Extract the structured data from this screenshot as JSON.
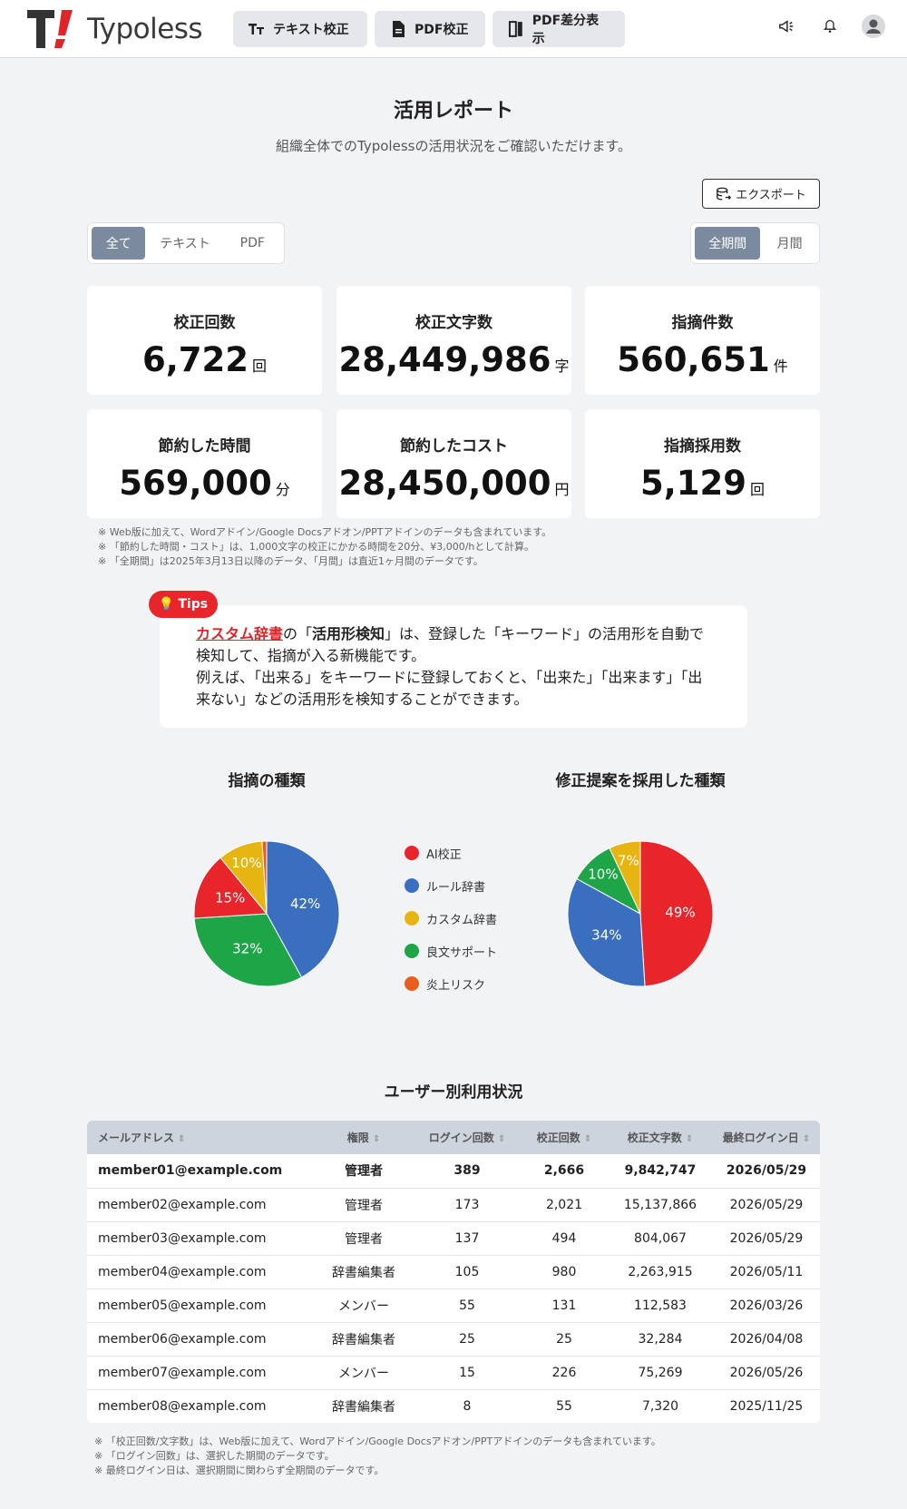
{
  "header": {
    "brand": "Typoless",
    "nav": [
      {
        "label": "テキスト校正",
        "icon": "text-size-icon"
      },
      {
        "label": "PDF校正",
        "icon": "document-icon"
      },
      {
        "label": "PDF差分表示",
        "icon": "diff-icon"
      }
    ],
    "icons": [
      "megaphone-icon",
      "bell-icon",
      "avatar-icon"
    ]
  },
  "page": {
    "title": "活用レポート",
    "subtitle": "組織全体でのTypolessの活用状況をご確認いただけます。",
    "export_label": "エクスポート"
  },
  "filters": {
    "type_options": [
      "全て",
      "テキスト",
      "PDF"
    ],
    "type_selected": "全て",
    "period_options": [
      "全期間",
      "月間"
    ],
    "period_selected": "全期間"
  },
  "stats": [
    {
      "label": "校正回数",
      "value": "6,722",
      "unit": "回"
    },
    {
      "label": "校正文字数",
      "value": "28,449,986",
      "unit": "字"
    },
    {
      "label": "指摘件数",
      "value": "560,651",
      "unit": "件"
    },
    {
      "label": "節約した時間",
      "value": "569,000",
      "unit": "分"
    },
    {
      "label": "節約したコスト",
      "value": "28,450,000",
      "unit": "円"
    },
    {
      "label": "指摘採用数",
      "value": "5,129",
      "unit": "回"
    }
  ],
  "stat_notes": [
    "※ Web版に加えて、Wordアドイン/Google Docsアドオン/PPTアドインのデータも含まれています。",
    "※ 「節約した時間・コスト」は、1,000文字の校正にかかる時間を20分、¥3,000/hとして計算。",
    "※ 「全期間」は2025年3月13日以降のデータ、「月間」は直近1ヶ月間のデータです。"
  ],
  "tips": {
    "badge": "Tips",
    "highlight": "カスタム辞書",
    "p1": "の「",
    "bold": "活用形検知",
    "p2": "」は、登録した「キーワード」の活用形を自動で検知して、指摘が入る新機能です。",
    "p3": "例えば、「出来る」をキーワードに登録しておくと、「出来た」「出来ます」「出来ない」などの活用形を検知することができます。"
  },
  "legend": [
    {
      "name": "AI校正",
      "color": "#e8252a"
    },
    {
      "name": "ルール辞書",
      "color": "#3a6fbf"
    },
    {
      "name": "カスタム辞書",
      "color": "#e7b512"
    },
    {
      "name": "良文サポート",
      "color": "#1ea547"
    },
    {
      "name": "炎上リスク",
      "color": "#ea5e1d"
    }
  ],
  "chart_data": [
    {
      "type": "pie",
      "title": "指摘の種類",
      "categories": [
        "ルール辞書",
        "良文サポート",
        "AI校正",
        "カスタム辞書",
        "炎上リスク"
      ],
      "values": [
        42,
        32,
        15,
        10,
        1
      ],
      "labels": [
        "42%",
        "32%",
        "15%",
        "10%",
        ""
      ],
      "colors": [
        "#3a6fbf",
        "#1ea547",
        "#e8252a",
        "#e7b512",
        "#ea5e1d"
      ]
    },
    {
      "type": "pie",
      "title": "修正提案を採用した種類",
      "categories": [
        "AI校正",
        "ルール辞書",
        "良文サポート",
        "カスタム辞書"
      ],
      "values": [
        49,
        34,
        10,
        7
      ],
      "labels": [
        "49%",
        "34%",
        "10%",
        "7%"
      ],
      "colors": [
        "#e8252a",
        "#3a6fbf",
        "#1ea547",
        "#e7b512"
      ]
    }
  ],
  "table": {
    "title": "ユーザー別利用状況",
    "columns": [
      "メールアドレス",
      "権限",
      "ログイン回数",
      "校正回数",
      "校正文字数",
      "最終ログイン日"
    ],
    "rows": [
      [
        "member01@example.com",
        "管理者",
        "389",
        "2,666",
        "9,842,747",
        "2026/05/29"
      ],
      [
        "member02@example.com",
        "管理者",
        "173",
        "2,021",
        "15,137,866",
        "2026/05/29"
      ],
      [
        "member03@example.com",
        "管理者",
        "137",
        "494",
        "804,067",
        "2026/05/29"
      ],
      [
        "member04@example.com",
        "辞書編集者",
        "105",
        "980",
        "2,263,915",
        "2026/05/11"
      ],
      [
        "member05@example.com",
        "メンバー",
        "55",
        "131",
        "112,583",
        "2026/03/26"
      ],
      [
        "member06@example.com",
        "辞書編集者",
        "25",
        "25",
        "32,284",
        "2026/04/08"
      ],
      [
        "member07@example.com",
        "メンバー",
        "15",
        "226",
        "75,269",
        "2026/05/26"
      ],
      [
        "member08@example.com",
        "辞書編集者",
        "8",
        "55",
        "7,320",
        "2025/11/25"
      ]
    ],
    "notes": [
      "※ 「校正回数/文字数」は、Web版に加えて、Wordアドイン/Google Docsアドオン/PPTアドインのデータも含まれています。",
      "※ 「ログイン回数」は、選択した期間のデータです。",
      "※ 最終ログイン日は、選択期間に関わらず全期間のデータです。"
    ]
  }
}
